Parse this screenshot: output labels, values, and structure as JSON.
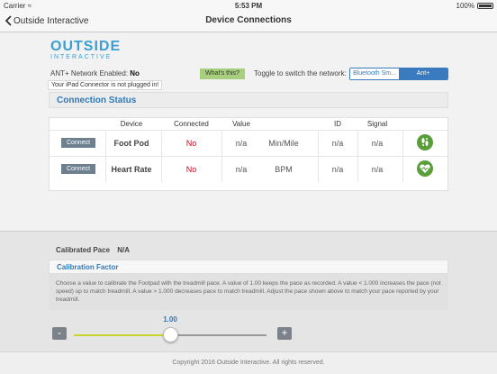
{
  "status_bar": {
    "carrier": "Carrier",
    "time": "5:53 PM",
    "battery": "100%"
  },
  "nav": {
    "back_label": "Outside Interactive",
    "title": "Device Connections"
  },
  "logo": {
    "line1": "OUTSIDE",
    "line2": "INTERACTIVE"
  },
  "ant": {
    "label": "ANT+ Network Enabled:",
    "value": "No",
    "notice": "Your iPad Connector is not plugged in!"
  },
  "whats_this": "What's this?",
  "toggle": {
    "label": "Toggle to switch the network:",
    "options": [
      "Bluetooth Sm...",
      "Ant+"
    ],
    "selected": "Ant+"
  },
  "connection_status": {
    "title": "Connection Status",
    "columns": [
      "Device",
      "Connected",
      "Value",
      "ID",
      "Signal"
    ],
    "rows": [
      {
        "button": "Connect",
        "device": "Foot Pod",
        "connected": "No",
        "value": "n/a",
        "unit": "Min/Mile",
        "id": "n/a",
        "signal": "n/a",
        "icon": "footprints-icon"
      },
      {
        "button": "Connect",
        "device": "Heart Rate",
        "connected": "No",
        "value": "n/a",
        "unit": "BPM",
        "id": "n/a",
        "signal": "n/a",
        "icon": "heart-rate-icon"
      }
    ]
  },
  "calibrated_pace": {
    "label": "Calibrated Pace",
    "value": "N/A"
  },
  "calibration": {
    "title": "Calibration Factor",
    "description": "Choose a value to calibrate the Footpad with the treadmill pace. A value of 1.00 keeps the pace as recorded. A value < 1.000 increases the pace (not speed) up to match treadmill. A value > 1.000 decreases pace to match treadmill. Adjust the pace shown above to match your pace reported by your treadmill.",
    "value": "1.00",
    "minus": "-",
    "plus": "+"
  },
  "footer": "Copyright 2016 Outside Interactive. All rights reserved.",
  "colors": {
    "accent": "#2f79b9",
    "danger": "#d0021b",
    "success": "#5a9e3a",
    "slider": "#c8d62e"
  }
}
